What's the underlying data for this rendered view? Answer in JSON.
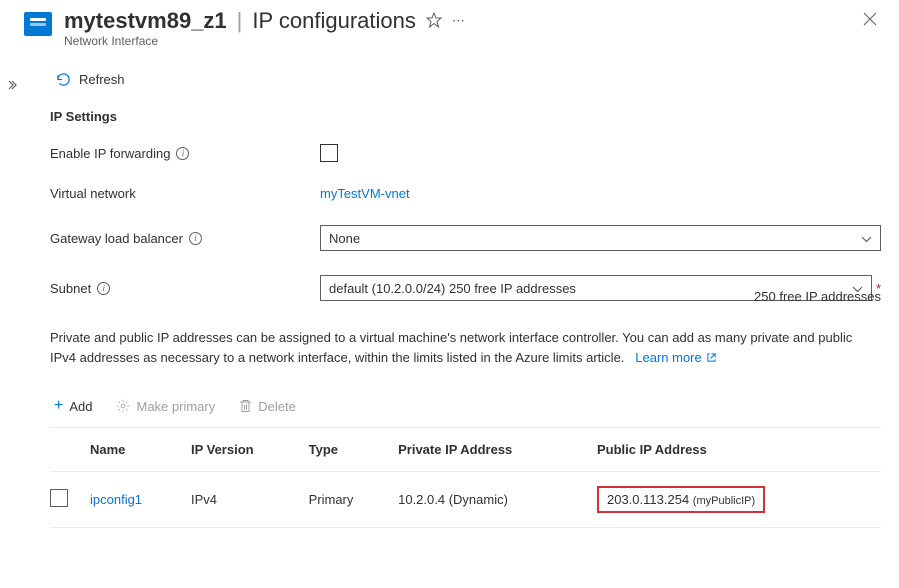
{
  "header": {
    "resource_name": "mytestvm89_z1",
    "page_title": "IP configurations",
    "resource_type": "Network Interface"
  },
  "toolbar": {
    "refresh_label": "Refresh"
  },
  "ip_settings": {
    "section_label": "IP Settings",
    "forwarding_label": "Enable IP forwarding",
    "vnet_label": "Virtual network",
    "vnet_link": "myTestVM-vnet",
    "gateway_label": "Gateway load balancer",
    "gateway_value": "None",
    "subnet_label": "Subnet",
    "subnet_value": "default (10.2.0.0/24) 250 free IP addresses",
    "subnet_helper": "250 free IP addresses"
  },
  "configs": {
    "description": "Private and public IP addresses can be assigned to a virtual machine's network interface controller. You can add as many private and public IPv4 addresses as necessary to a network interface, within the limits listed in the Azure limits article.",
    "learn_more": "Learn more",
    "actions": {
      "add": "Add",
      "make_primary": "Make primary",
      "delete": "Delete"
    },
    "columns": {
      "name": "Name",
      "ip_version": "IP Version",
      "type": "Type",
      "private": "Private IP Address",
      "public": "Public IP Address"
    },
    "rows": [
      {
        "name": "ipconfig1",
        "ip_version": "IPv4",
        "type": "Primary",
        "private": "10.2.0.4 (Dynamic)",
        "public_ip": "203.0.113.254",
        "public_name": "(myPublicIP)"
      }
    ]
  }
}
